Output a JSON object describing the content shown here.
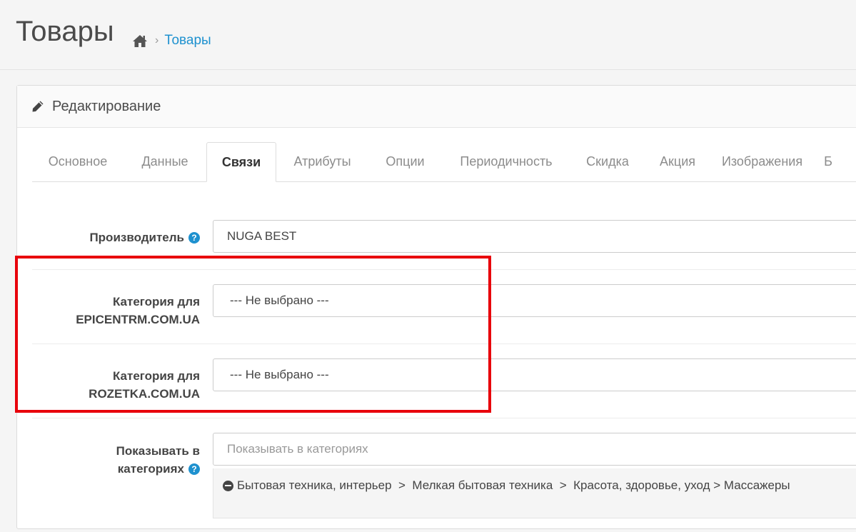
{
  "header": {
    "title": "Товары",
    "breadcrumb": {
      "home_icon": "home-icon",
      "separator": "›",
      "current": "Товары"
    }
  },
  "panel": {
    "heading_icon": "pencil-icon",
    "heading": "Редактирование"
  },
  "tabs": [
    {
      "label": "Основное",
      "active": false
    },
    {
      "label": "Данные",
      "active": false
    },
    {
      "label": "Связи",
      "active": true
    },
    {
      "label": "Атрибуты",
      "active": false
    },
    {
      "label": "Опции",
      "active": false
    },
    {
      "label": "Периодичность",
      "active": false
    },
    {
      "label": "Скидка",
      "active": false
    },
    {
      "label": "Акция",
      "active": false
    },
    {
      "label": "Изображения",
      "active": false
    },
    {
      "label": "Б",
      "active": false
    }
  ],
  "form": {
    "manufacturer": {
      "label": "Производитель",
      "value": "NUGA BEST"
    },
    "epicentr": {
      "label_line1": "Категория для",
      "label_line2": "EPICENTRM.COM.UA",
      "selected": "--- Не выбрано ---"
    },
    "rozetka": {
      "label_line1": "Категория для",
      "label_line2": "ROZETKA.COM.UA",
      "selected": "--- Не выбрано ---"
    },
    "categories": {
      "label_line1": "Показывать в",
      "label_line2": "категориях",
      "placeholder": "Показывать в категориях",
      "items": [
        "Бытовая техника, интерьер  >  Мелкая бытовая техника  >  Красота, здоровье, уход > Массажеры"
      ]
    }
  },
  "colors": {
    "accent": "#1e91cf",
    "highlight": "#e8000b"
  }
}
